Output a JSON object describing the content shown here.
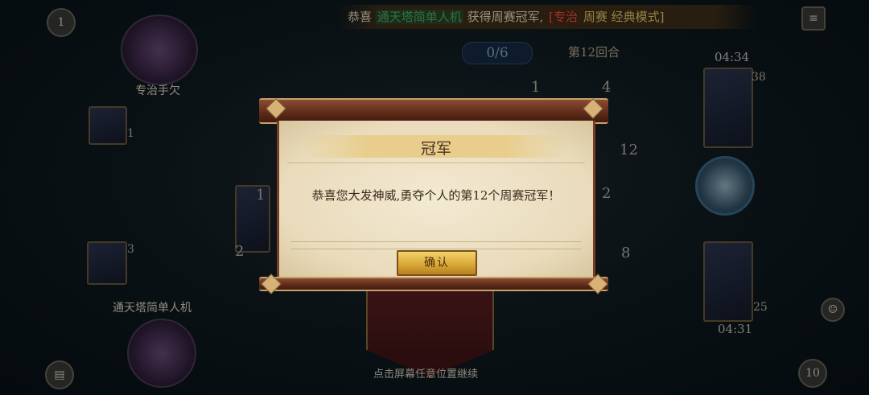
{
  "marquee": {
    "prefix": "恭喜",
    "winner": "通天塔简单人机",
    "mid": "获得周赛冠军,",
    "mode_open": "[",
    "champion_alias": "专治",
    "mode_name": "周赛 经典模式",
    "mode_close": "]"
  },
  "hud": {
    "score_counter": "0/6",
    "round": "第12回合",
    "timer_top": "04:34",
    "timer_bottom": "04:31",
    "left_badge": "1",
    "left_stat_1": "1",
    "left_stat_2": "3",
    "right_count_1": "38",
    "right_count_2": "25",
    "board_nums": [
      "1",
      "4",
      "12",
      "1",
      "2",
      "2",
      "8"
    ],
    "bottom_right_badge": "10"
  },
  "players": {
    "top_name": "专治手欠",
    "bottom_name": "通天塔简单人机"
  },
  "bottom_hint": "点击屏幕任意位置继续",
  "dialog": {
    "title": "冠军",
    "message": "恭喜您大发神威,勇夺个人的第12个周赛冠军！",
    "confirm_label": "确认"
  },
  "colors": {
    "winner_green": "#3fb36b",
    "champion_red": "#e05a3c",
    "button_gold": "#d7a534",
    "scroll_rod": "#5d2a18"
  }
}
